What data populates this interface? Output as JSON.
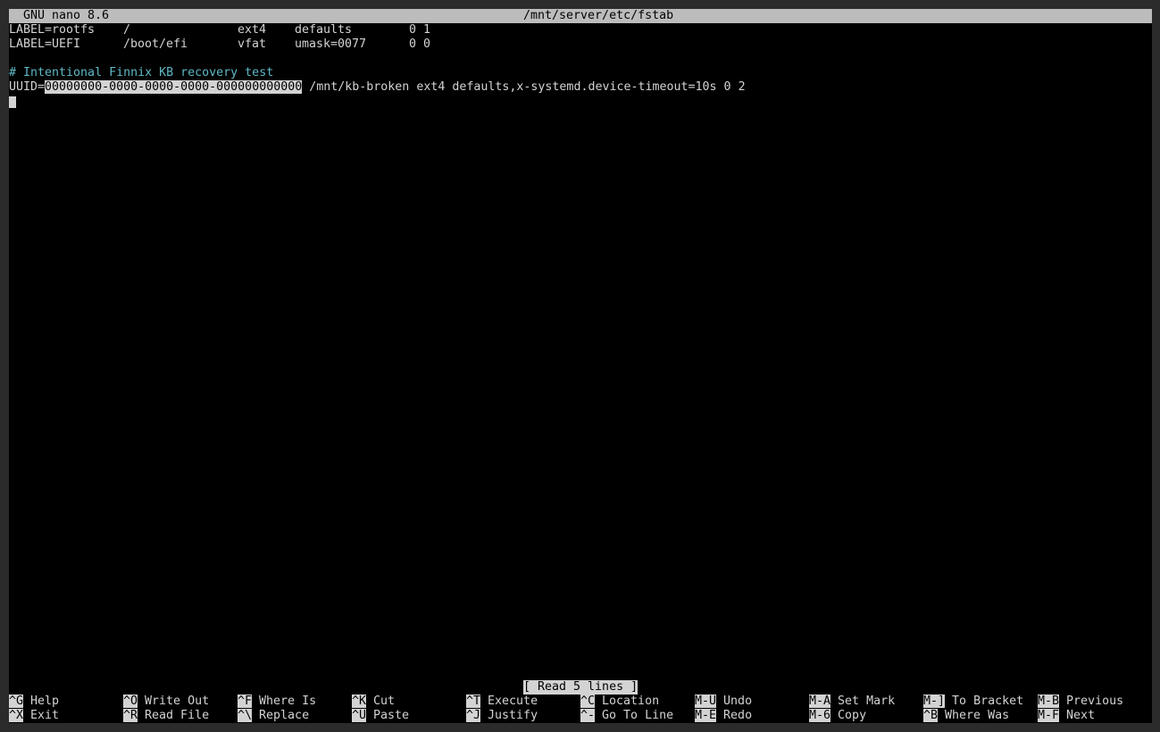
{
  "titlebar": {
    "app": "GNU nano 8.6",
    "file": "/mnt/server/etc/fstab"
  },
  "lines": {
    "line1": {
      "spec": "LABEL=rootfs",
      "mount": "/",
      "type": "ext4",
      "options": "defaults",
      "dump_pass": "0 1"
    },
    "line2": {
      "spec": "LABEL=UEFI",
      "mount": "/boot/efi",
      "type": "vfat",
      "options": "umask=0077",
      "dump_pass": "0 0"
    },
    "comment": "# Intentional Finnix KB recovery test",
    "line5": {
      "prefix": "UUID=",
      "selected": "00000000-0000-0000-0000-000000000000",
      "rest": " /mnt/kb-broken ext4 defaults,x-systemd.device-timeout=10s 0 2"
    }
  },
  "status": "[ Read 5 lines ]",
  "shortcuts": {
    "s0": {
      "key": "^G",
      "label": "Help"
    },
    "s1": {
      "key": "^O",
      "label": "Write Out"
    },
    "s2": {
      "key": "^F",
      "label": "Where Is"
    },
    "s3": {
      "key": "^K",
      "label": "Cut"
    },
    "s4": {
      "key": "^T",
      "label": "Execute"
    },
    "s5": {
      "key": "^C",
      "label": "Location"
    },
    "s6": {
      "key": "M-U",
      "label": "Undo"
    },
    "s7": {
      "key": "M-A",
      "label": "Set Mark"
    },
    "s8": {
      "key": "M-]",
      "label": "To Bracket"
    },
    "s9": {
      "key": "M-B",
      "label": "Previous"
    },
    "t0": {
      "key": "^X",
      "label": "Exit"
    },
    "t1": {
      "key": "^R",
      "label": "Read File"
    },
    "t2": {
      "key": "^\\",
      "label": "Replace"
    },
    "t3": {
      "key": "^U",
      "label": "Paste"
    },
    "t4": {
      "key": "^J",
      "label": "Justify"
    },
    "t5": {
      "key": "^-",
      "label": "Go To Line"
    },
    "t6": {
      "key": "M-E",
      "label": "Redo"
    },
    "t7": {
      "key": "M-6",
      "label": "Copy"
    },
    "t8": {
      "key": "^B",
      "label": "Where Was"
    },
    "t9": {
      "key": "M-F",
      "label": "Next"
    }
  }
}
